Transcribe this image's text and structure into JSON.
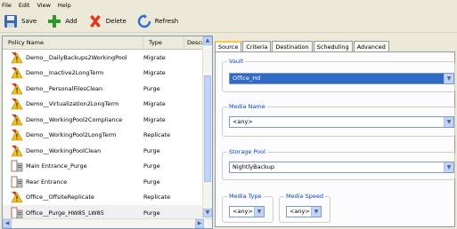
{
  "menu": [
    "File",
    "Edit",
    "View",
    "Help"
  ],
  "toolbar": {
    "save": "Save",
    "add": "Add",
    "delete": "Delete",
    "refresh": "Refresh"
  },
  "list": {
    "headers": [
      "Policy Name",
      "Type",
      "Descripti"
    ],
    "rows": [
      {
        "name": "Demo__DailyBackups2WorkingPool",
        "type": "Migrate",
        "icon": "warning-policy-icon"
      },
      {
        "name": "Demo__Inactive2LongTerm",
        "type": "Migrate",
        "icon": "warning-policy-icon"
      },
      {
        "name": "Demo__PersonalFilesClean",
        "type": "Purge",
        "icon": "warning-policy-icon"
      },
      {
        "name": "Demo__Virtualization2LongTerm",
        "type": "Migrate",
        "icon": "warning-policy-icon"
      },
      {
        "name": "Demo__WorkingPool2Compliance",
        "type": "Migrate",
        "icon": "warning-policy-icon"
      },
      {
        "name": "Demo__WorkingPool2LongTerm",
        "type": "Replicate",
        "icon": "warning-policy-icon"
      },
      {
        "name": "Demo__WorkingPoolClean",
        "type": "Purge",
        "icon": "warning-policy-icon"
      },
      {
        "name": "Main Entrance_Purge",
        "type": "Purge",
        "icon": "document-policy-icon"
      },
      {
        "name": "Rear Entrance",
        "type": "Purge",
        "icon": "document-policy-icon"
      },
      {
        "name": "Office__OffsiteReplicate",
        "type": "Replicate",
        "icon": "warning-policy-icon"
      },
      {
        "name": "Office__Purge_HW85_LW85",
        "type": "Purge",
        "icon": "document-policy-icon"
      }
    ]
  },
  "tabs": [
    "Source",
    "Criteria",
    "Destination",
    "Scheduling",
    "Advanced"
  ],
  "source": {
    "vault_label": "Vault",
    "vault_value": "Office_Hd",
    "media_name_label": "Media Name",
    "media_name_value": "<any>",
    "storage_pool_label": "Storage Pool",
    "storage_pool_value": "NightlyBackup",
    "media_type_label": "Media Type",
    "media_type_value": "<any>",
    "media_speed_label": "Media Speed",
    "media_speed_value": "<any>"
  },
  "colors": {
    "selection": "#316ac5",
    "group_label": "#0046d5",
    "active_tab_accent": "#ffc83c"
  }
}
